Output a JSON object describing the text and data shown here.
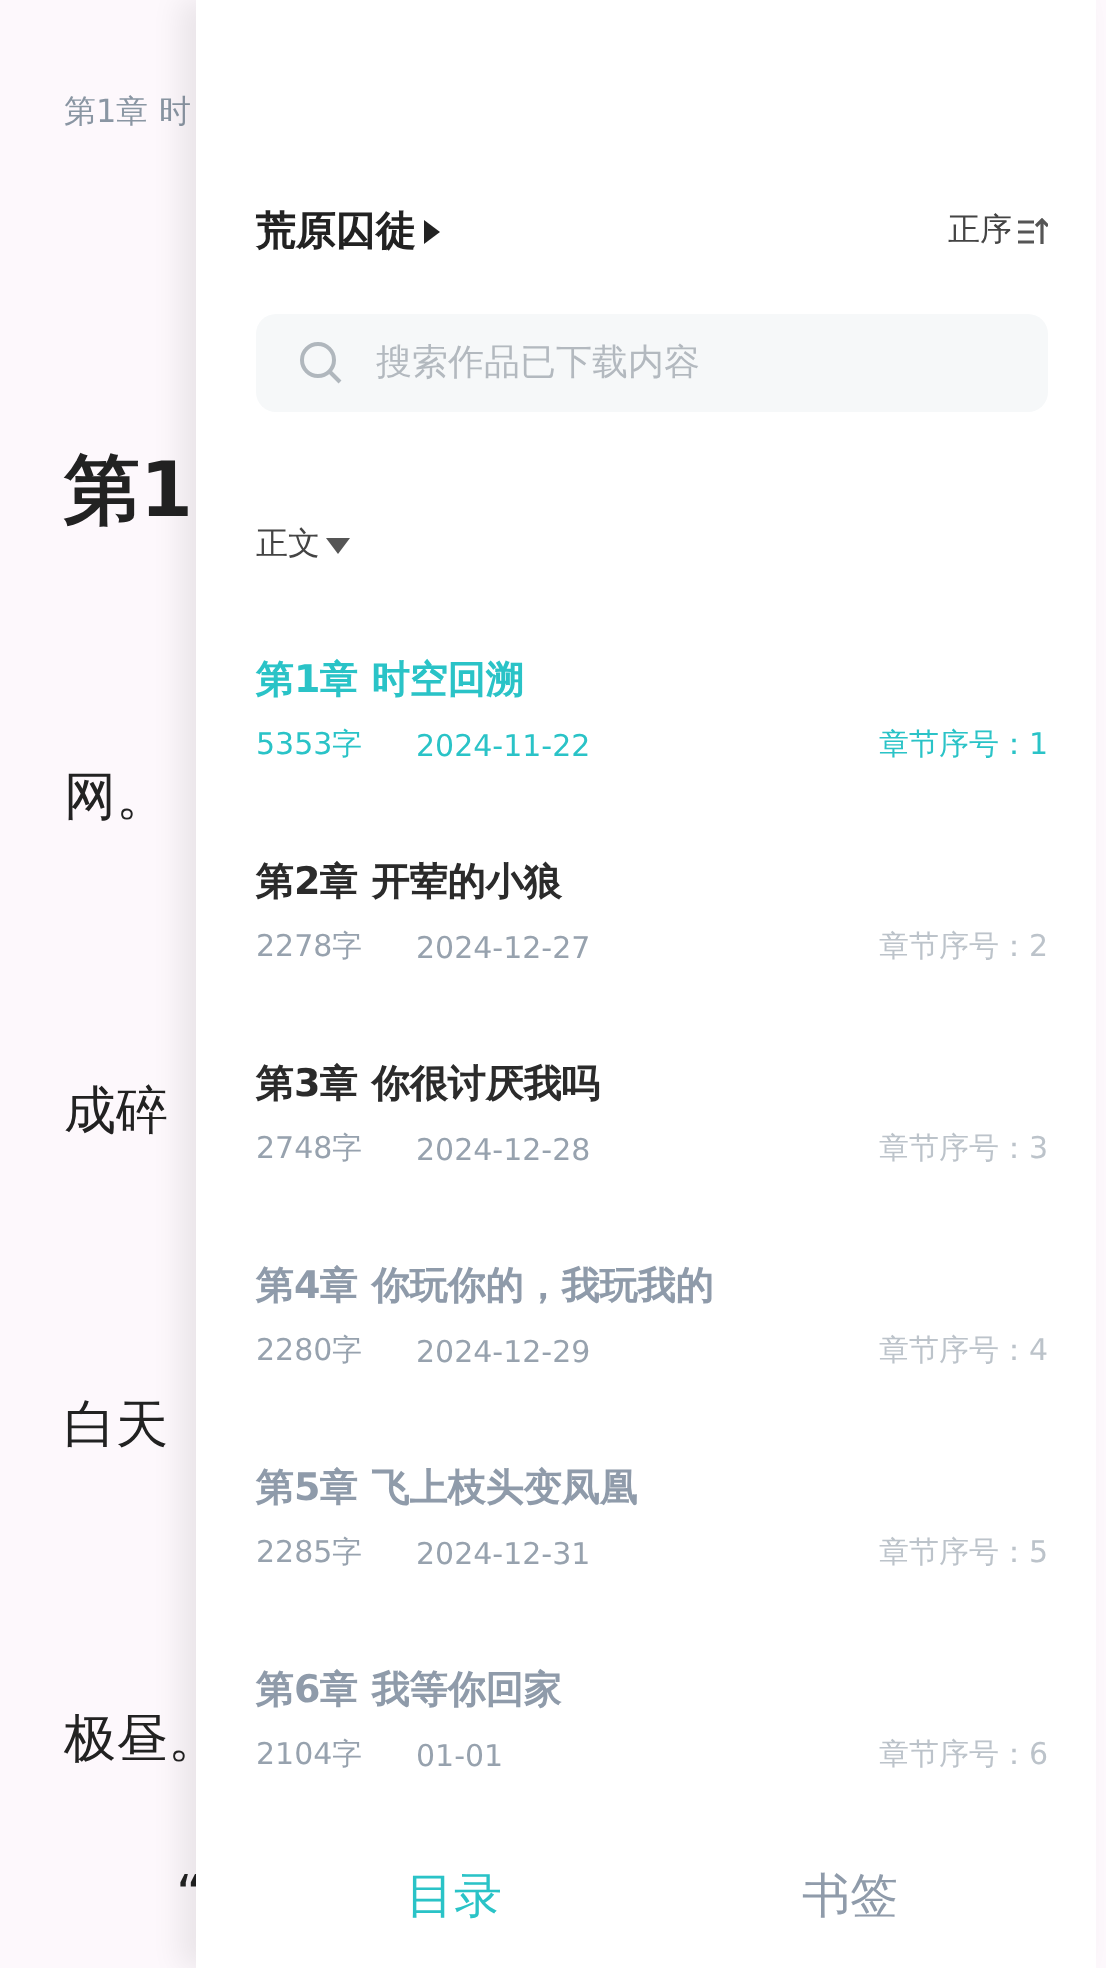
{
  "reader": {
    "chapter_header": "第1章 时",
    "heading": "第1",
    "lines": [
      "网。",
      "成碎",
      "白天",
      "极昼。",
      "“"
    ]
  },
  "drawer": {
    "book_title": "荒原囚徒",
    "sort_label": "正序",
    "search": {
      "placeholder": "搜索作品已下载内容"
    },
    "volume_label": "正文",
    "chapters": [
      {
        "title": "第1章 时空回溯",
        "words": "5353字",
        "date": "2024-11-22",
        "seq": "章节序号：1",
        "selected": true,
        "downloaded": true
      },
      {
        "title": "第2章 开荤的小狼",
        "words": "2278字",
        "date": "2024-12-27",
        "seq": "章节序号：2",
        "selected": false,
        "downloaded": true
      },
      {
        "title": "第3章 你很讨厌我吗",
        "words": "2748字",
        "date": "2024-12-28",
        "seq": "章节序号：3",
        "selected": false,
        "downloaded": true
      },
      {
        "title": "第4章 你玩你的，我玩我的",
        "words": "2280字",
        "date": "2024-12-29",
        "seq": "章节序号：4",
        "selected": false,
        "downloaded": false
      },
      {
        "title": "第5章 飞上枝头变凤凰",
        "words": "2285字",
        "date": "2024-12-31",
        "seq": "章节序号：5",
        "selected": false,
        "downloaded": false
      },
      {
        "title": "第6章 我等你回家",
        "words": "2104字",
        "date": "01-01",
        "seq": "章节序号：6",
        "selected": false,
        "downloaded": false
      }
    ],
    "tabs": [
      {
        "label": "目录",
        "selected": true
      },
      {
        "label": "书签",
        "selected": false
      }
    ]
  }
}
